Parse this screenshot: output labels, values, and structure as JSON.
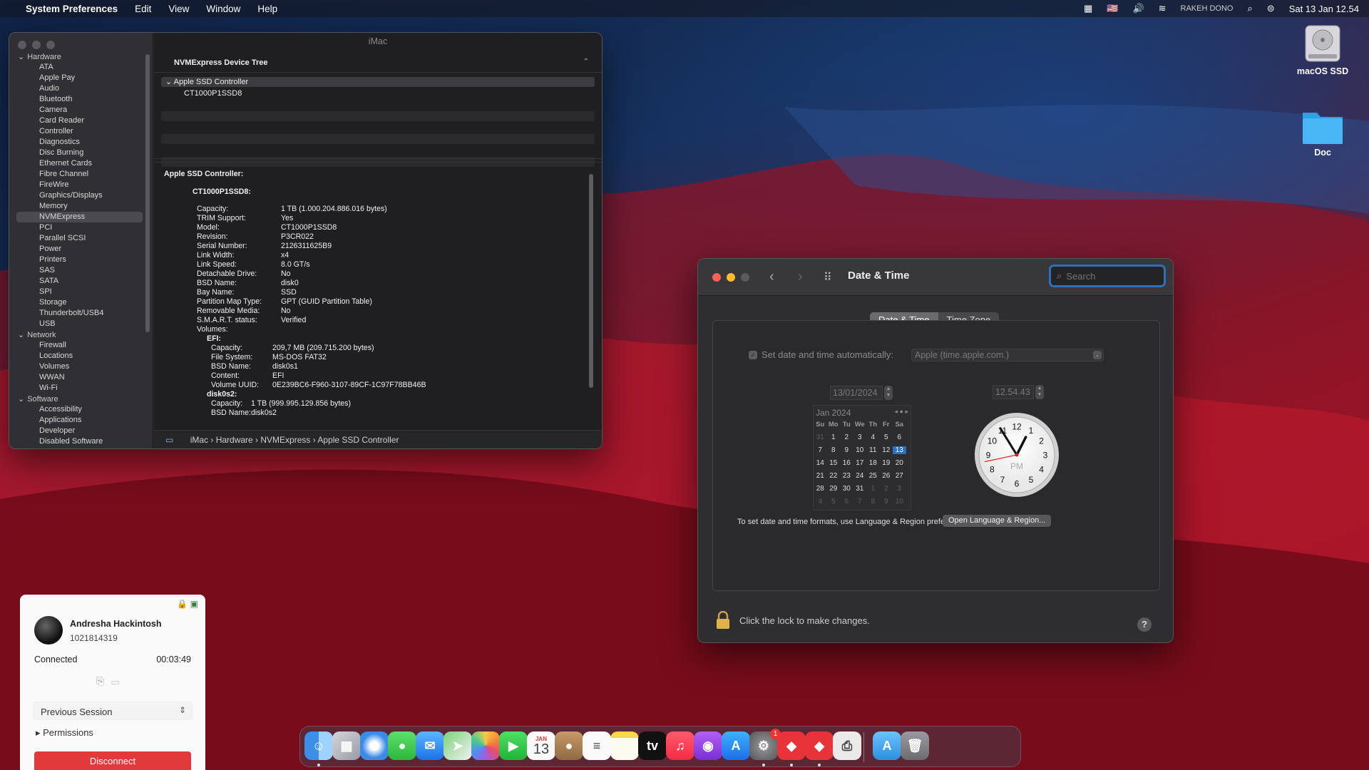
{
  "menubar": {
    "app": "System Preferences",
    "items": [
      "Edit",
      "View",
      "Window",
      "Help"
    ],
    "user": "RAKEH DONO",
    "clock": "Sat 13 Jan  12.54"
  },
  "desktop": {
    "icons": [
      {
        "label": "macOS SSD"
      },
      {
        "label": "Doc"
      }
    ]
  },
  "sysinfo": {
    "title": "iMac",
    "sidebar": [
      {
        "group": "Hardware",
        "items": [
          "ATA",
          "Apple Pay",
          "Audio",
          "Bluetooth",
          "Camera",
          "Card Reader",
          "Controller",
          "Diagnostics",
          "Disc Burning",
          "Ethernet Cards",
          "Fibre Channel",
          "FireWire",
          "Graphics/Displays",
          "Memory",
          "NVMExpress",
          "PCI",
          "Parallel SCSI",
          "Power",
          "Printers",
          "SAS",
          "SATA",
          "SPI",
          "Storage",
          "Thunderbolt/USB4",
          "USB"
        ]
      },
      {
        "group": "Network",
        "items": [
          "Firewall",
          "Locations",
          "Volumes",
          "WWAN",
          "Wi-Fi"
        ]
      },
      {
        "group": "Software",
        "items": [
          "Accessibility",
          "Applications",
          "Developer",
          "Disabled Software"
        ]
      }
    ],
    "selected": "NVMExpress",
    "tree_header": "NVMExpress Device Tree",
    "tree": [
      "Apple SSD Controller",
      "CT1000P1SSD8"
    ],
    "detail_title": "Apple SSD Controller:",
    "detail_device": "CT1000P1SSD8:",
    "props": [
      [
        "Capacity:",
        "1 TB (1.000.204.886.016 bytes)"
      ],
      [
        "TRIM Support:",
        "Yes"
      ],
      [
        "Model:",
        "CT1000P1SSD8"
      ],
      [
        "Revision:",
        "P3CR022"
      ],
      [
        "Serial Number:",
        "2126311625B9"
      ],
      [
        "Link Width:",
        "x4"
      ],
      [
        "Link Speed:",
        "8.0 GT/s"
      ],
      [
        "Detachable Drive:",
        "No"
      ],
      [
        "BSD Name:",
        "disk0"
      ],
      [
        "Bay Name:",
        "SSD"
      ],
      [
        "Partition Map Type:",
        "GPT (GUID Partition Table)"
      ],
      [
        "Removable Media:",
        "No"
      ],
      [
        "S.M.A.R.T. status:",
        "Verified"
      ]
    ],
    "volumes_label": "Volumes:",
    "efi_label": "EFI:",
    "efi": [
      [
        "Capacity:",
        "209,7 MB (209.715.200 bytes)"
      ],
      [
        "File System:",
        "MS-DOS FAT32"
      ],
      [
        "BSD Name:",
        "disk0s1"
      ],
      [
        "Content:",
        "EFI"
      ],
      [
        "Volume UUID:",
        "0E239BC6-F960-3107-89CF-1C97F78BB46B"
      ]
    ],
    "disk0s2_label": "disk0s2:",
    "disk0s2": [
      [
        "Capacity:",
        "1 TB (999.995.129.856 bytes)"
      ],
      [
        "BSD Name:",
        "disk0s2"
      ]
    ],
    "breadcrumb": "iMac › Hardware › NVMExpress › Apple SSD Controller"
  },
  "datetime": {
    "title": "Date & Time",
    "search_placeholder": "Search",
    "tabs": [
      "Date & Time",
      "Time Zone"
    ],
    "auto_label": "Set date and time automatically:",
    "server": "Apple (time.apple.com.)",
    "date": "13/01/2024",
    "time": "12.54.43",
    "cal_month": "Jan 2024",
    "weekdays": [
      "Su",
      "Mo",
      "Tu",
      "We",
      "Th",
      "Fr",
      "Sa"
    ],
    "weeks": [
      [
        31,
        1,
        2,
        3,
        4,
        5,
        6
      ],
      [
        7,
        8,
        9,
        10,
        11,
        12,
        13
      ],
      [
        14,
        15,
        16,
        17,
        18,
        19,
        20
      ],
      [
        21,
        22,
        23,
        24,
        25,
        26,
        27
      ],
      [
        28,
        29,
        30,
        31,
        1,
        2,
        3
      ],
      [
        4,
        5,
        6,
        7,
        8,
        9,
        10
      ]
    ],
    "today": 13,
    "clock_ampm": "PM",
    "clock_time": {
      "hour": 12,
      "minute": 54,
      "second": 43
    },
    "format_note": "To set date and time formats, use Language & Region preferences.",
    "format_button": "Open Language & Region...",
    "lock_note": "Click the lock to make changes.",
    "help": "?"
  },
  "anydesk": {
    "name": "Andresha Hackintosh",
    "id": "1021814319",
    "status": "Connected",
    "timer": "00:03:49",
    "session": "Previous Session",
    "permissions": "Permissions",
    "disconnect": "Disconnect"
  },
  "dock": {
    "calendar_month": "JAN",
    "calendar_day": "13",
    "badge": "1",
    "apps": [
      "Finder",
      "Launchpad",
      "Safari",
      "Messages",
      "Mail",
      "Maps",
      "Photos",
      "FaceTime",
      "Calendar",
      "Contacts",
      "Reminders",
      "Notes",
      "TV",
      "Music",
      "Podcasts",
      "App Store",
      "System Preferences",
      "AnyDesk",
      "AnyDesk",
      "Printer",
      "Downloads",
      "Trash"
    ]
  },
  "colors": {
    "accent": "#2f6fb7",
    "disconnect": "#e23a3a"
  }
}
